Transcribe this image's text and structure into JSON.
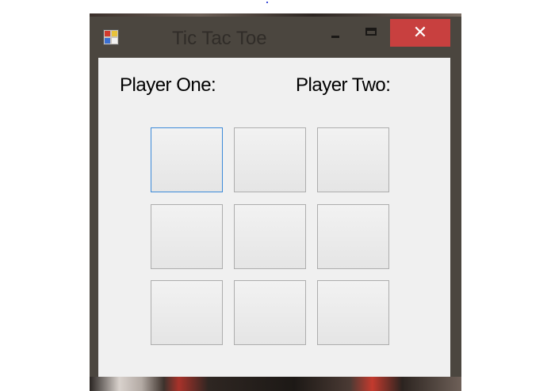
{
  "window": {
    "title": "Tic Tac Toe",
    "close_glyph": "✕",
    "icons": {
      "app": "app-icon",
      "minimize": "minimize-icon",
      "maximize": "maximize-icon",
      "close": "close-icon"
    }
  },
  "labels": {
    "player_one": "Player One:",
    "player_two": "Player Two:"
  },
  "board": {
    "cells": [
      "",
      "",
      "",
      "",
      "",
      "",
      "",
      "",
      ""
    ],
    "focused_cell": 0
  },
  "colors": {
    "frame": "#4b463f",
    "client": "#f0f0f0",
    "close_button": "#c8403f",
    "focus_border": "#3c8ad9",
    "cell_border": "#adadad"
  }
}
